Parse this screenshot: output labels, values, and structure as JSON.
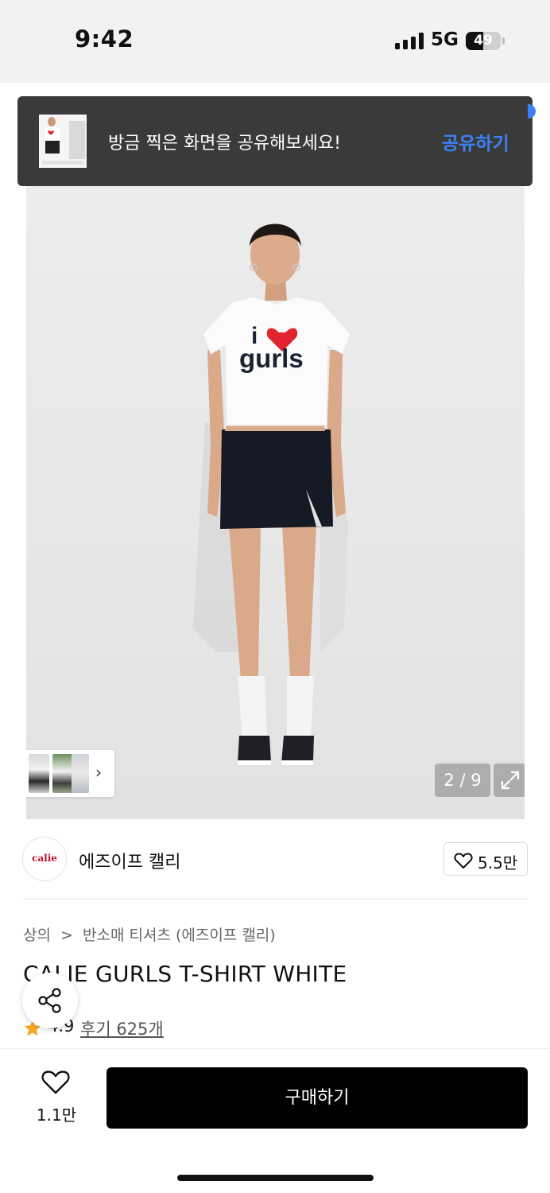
{
  "status": {
    "time": "9:42",
    "network": "5G",
    "battery": "49",
    "battery_level_percent": 49
  },
  "toast": {
    "message": "방금 찍은 화면을 공유해보세요!",
    "action": "공유하기"
  },
  "hero": {
    "shirt_text_top": "i",
    "shirt_text_bottom": "gurls",
    "counter": "2 / 9"
  },
  "brand": {
    "logo_text": "calie",
    "name": "에즈이프 캘리",
    "likes": "5.5만"
  },
  "breadcrumb": {
    "items": [
      "상의",
      "반소매 티셔츠 (에즈이프 캘리)"
    ],
    "separator": ">"
  },
  "product": {
    "title": "CALIE GURLS T-SHIRT WHITE",
    "rating": "4.9",
    "reviews": "후기 625개"
  },
  "bottom": {
    "wish_count": "1.1만",
    "buy_label": "구매하기"
  },
  "colors": {
    "accent": "#3b82f6",
    "toast_bg": "#3a3a3a",
    "star": "#f5a623",
    "brand_logo": "#c8102e",
    "heart": "#e0252f"
  }
}
